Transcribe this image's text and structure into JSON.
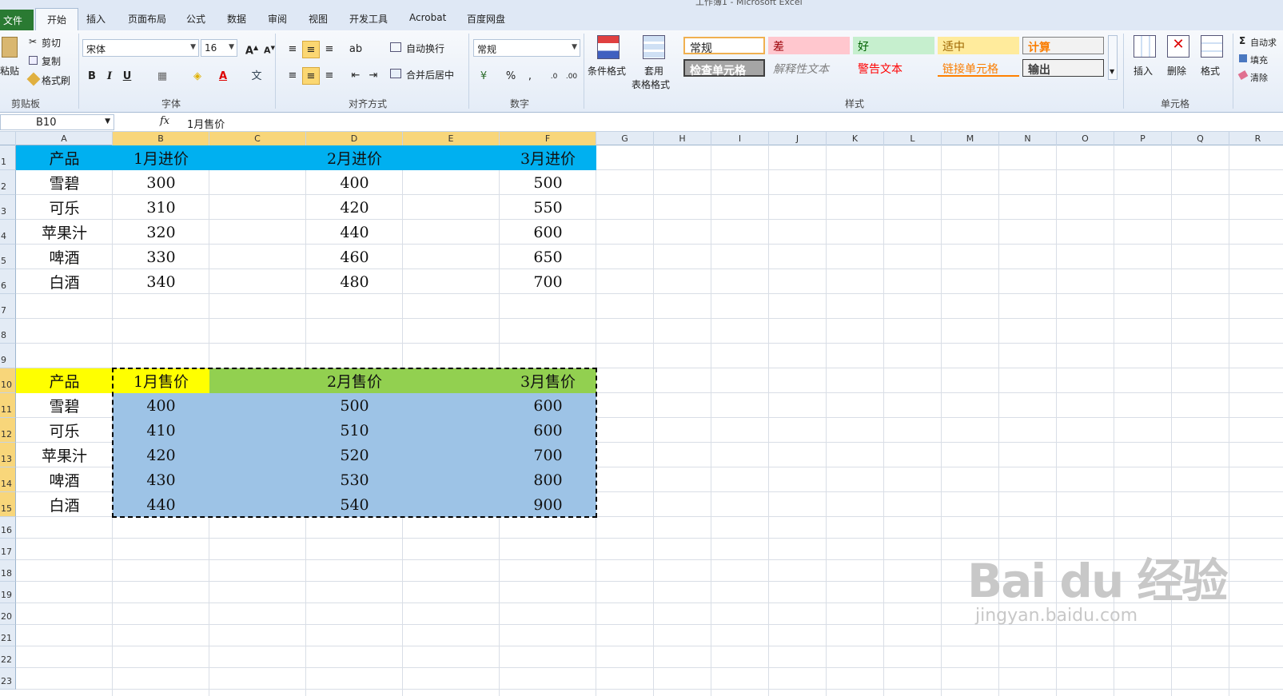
{
  "window": {
    "title": "工作簿1 - Microsoft Excel"
  },
  "tabs": [
    "文件",
    "开始",
    "插入",
    "页面布局",
    "公式",
    "数据",
    "审阅",
    "视图",
    "开发工具",
    "Acrobat",
    "百度网盘"
  ],
  "ribbon": {
    "clipboard": {
      "paste": "粘贴",
      "cut": "剪切",
      "copy": "复制",
      "format_painter": "格式刷",
      "group": "剪贴板"
    },
    "font": {
      "name": "宋体",
      "size": "16",
      "group": "字体"
    },
    "alignment": {
      "wrap": "自动换行",
      "merge": "合并后居中",
      "group": "对齐方式"
    },
    "number": {
      "format": "常规",
      "group": "数字"
    },
    "styles": {
      "conditional": "条件格式",
      "table_format_1": "套用",
      "table_format_2": "表格格式",
      "items": [
        "常规",
        "差",
        "好",
        "适中",
        "计算",
        "检查单元格",
        "解释性文本",
        "警告文本",
        "链接单元格",
        "输出"
      ],
      "group": "样式"
    },
    "cells": {
      "insert": "插入",
      "delete": "删除",
      "format": "格式",
      "group": "单元格"
    },
    "editing": {
      "autosum": "自动求",
      "fill": "填充",
      "clear": "清除"
    }
  },
  "formula_bar": {
    "name_box": "B10",
    "fx": "fx",
    "content": "1月售价"
  },
  "columns": [
    "A",
    "B",
    "C",
    "D",
    "E",
    "F",
    "G",
    "H",
    "I",
    "J",
    "K",
    "L",
    "M",
    "N",
    "O",
    "P",
    "Q",
    "R"
  ],
  "rows": [
    "1",
    "2",
    "3",
    "4",
    "5",
    "6",
    "7",
    "8",
    "9",
    "10",
    "11",
    "12",
    "13",
    "14",
    "15",
    "16",
    "17",
    "18",
    "19",
    "20",
    "21",
    "22",
    "23"
  ],
  "table1": {
    "header": [
      "产品",
      "1月进价",
      "2月进价",
      "3月进价"
    ],
    "rows": [
      [
        "雪碧",
        "300",
        "400",
        "500"
      ],
      [
        "可乐",
        "310",
        "420",
        "550"
      ],
      [
        "苹果汁",
        "320",
        "440",
        "600"
      ],
      [
        "啤酒",
        "330",
        "460",
        "650"
      ],
      [
        "白酒",
        "340",
        "480",
        "700"
      ]
    ]
  },
  "table2": {
    "header": [
      "产品",
      "1月售价",
      "2月售价",
      "3月售价"
    ],
    "rows": [
      [
        "雪碧",
        "400",
        "500",
        "600"
      ],
      [
        "可乐",
        "410",
        "510",
        "600"
      ],
      [
        "苹果汁",
        "420",
        "520",
        "700"
      ],
      [
        "啤酒",
        "430",
        "530",
        "800"
      ],
      [
        "白酒",
        "440",
        "540",
        "900"
      ]
    ]
  },
  "colors": {
    "header1": "#00b0f0",
    "header2_a": "#ffff00",
    "header2_rest": "#92d050",
    "body2": "#9dc3e6",
    "selected": "#f8d67a"
  },
  "watermark": {
    "big": "Bai du 经验",
    "small": "jingyan.baidu.com"
  }
}
